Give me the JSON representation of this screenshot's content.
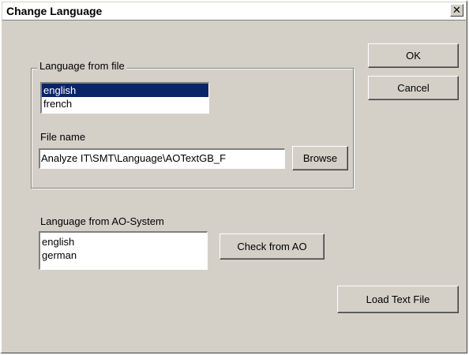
{
  "window": {
    "title": "Change Language",
    "close_glyph": "✕"
  },
  "file_group": {
    "legend": "Language from file",
    "languages": [
      "english",
      "french"
    ],
    "selected_index": 0,
    "file_name_label": "File name",
    "file_name_value": "Analyze IT\\SMT\\Language\\AOTextGB_F",
    "browse_label": "Browse"
  },
  "ao_group": {
    "label": "Language from AO-System",
    "languages": [
      "english",
      "german"
    ],
    "check_label": "Check  from AO"
  },
  "buttons": {
    "ok_label": "OK",
    "cancel_label": "Cancel",
    "load_label": "Load Text File"
  },
  "colors": {
    "face": "#d4d0c8",
    "selection": "#0a246a"
  }
}
